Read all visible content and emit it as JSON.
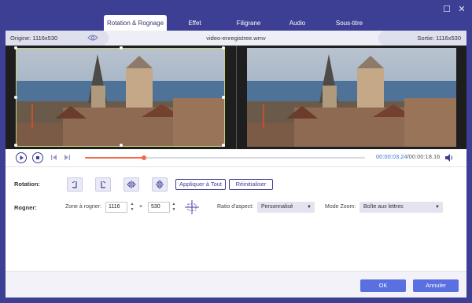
{
  "window": {
    "restore_glyph": "☐",
    "close_glyph": "✕"
  },
  "tabs": [
    {
      "label": "Rotation & Rognage",
      "active": true
    },
    {
      "label": "Effet",
      "active": false
    },
    {
      "label": "Filigrane",
      "active": false
    },
    {
      "label": "Audio",
      "active": false
    },
    {
      "label": "Sous-titre",
      "active": false
    }
  ],
  "infobar": {
    "origin": "Origine: 1116x530",
    "filename": "video-enregistree.wmv",
    "output": "Sortie: 1116x530"
  },
  "playback": {
    "current_time": "00:00:03.24",
    "total_time": "/00:00:18.16",
    "progress": 0.21
  },
  "rotation": {
    "label": "Rotation:",
    "apply_all_label": "Appliquer à Tout",
    "reset_label": "Réinitialiser"
  },
  "crop": {
    "label": "Rogner:",
    "zone_label": "Zone à rogner:",
    "width": "1116",
    "times": "×",
    "height": "530",
    "aspect_label": "Ratio d'aspect:",
    "aspect_value": "Personnalisé",
    "zoom_label": "Mode Zoom:",
    "zoom_value": "Boîte aux lettres"
  },
  "footer": {
    "ok_label": "OK",
    "cancel_label": "Annuler"
  },
  "colors": {
    "accent": "#3c3f94",
    "button_blue": "#5a70e0",
    "progress": "#ef6b4f",
    "time": "#3b6fd4"
  }
}
